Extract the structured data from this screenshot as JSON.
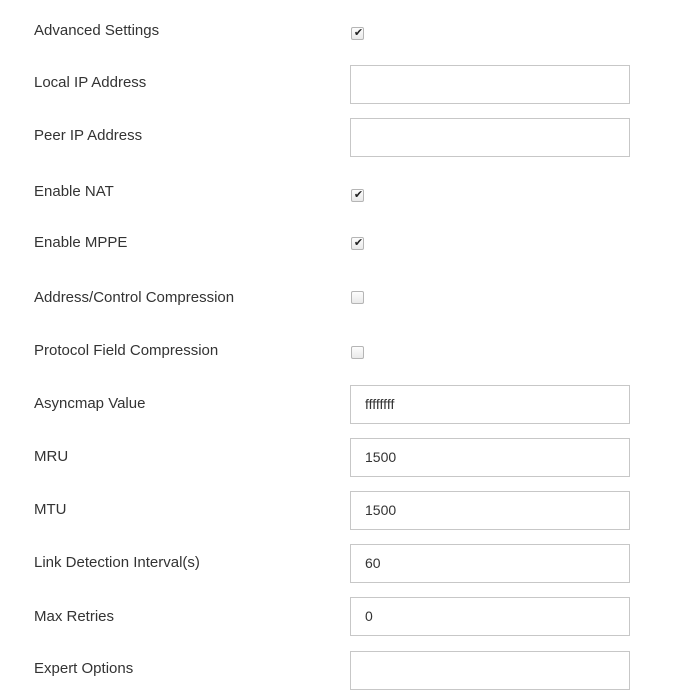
{
  "fields": {
    "advanced_settings": {
      "label": "Advanced Settings",
      "checked": true
    },
    "local_ip": {
      "label": "Local IP Address",
      "value": ""
    },
    "peer_ip": {
      "label": "Peer IP Address",
      "value": ""
    },
    "enable_nat": {
      "label": "Enable NAT",
      "checked": true
    },
    "enable_mppe": {
      "label": "Enable MPPE",
      "checked": true
    },
    "addr_ctrl_compression": {
      "label": "Address/Control Compression",
      "checked": false
    },
    "protocol_field_compression": {
      "label": "Protocol Field Compression",
      "checked": false
    },
    "asyncmap": {
      "label": "Asyncmap Value",
      "value": "ffffffff"
    },
    "mru": {
      "label": "MRU",
      "value": "1500"
    },
    "mtu": {
      "label": "MTU",
      "value": "1500"
    },
    "link_detection": {
      "label": "Link Detection Interval(s)",
      "value": "60"
    },
    "max_retries": {
      "label": "Max Retries",
      "value": "0"
    },
    "expert_options": {
      "label": "Expert Options",
      "value": ""
    }
  },
  "icons": {
    "checked": "check-mark"
  }
}
